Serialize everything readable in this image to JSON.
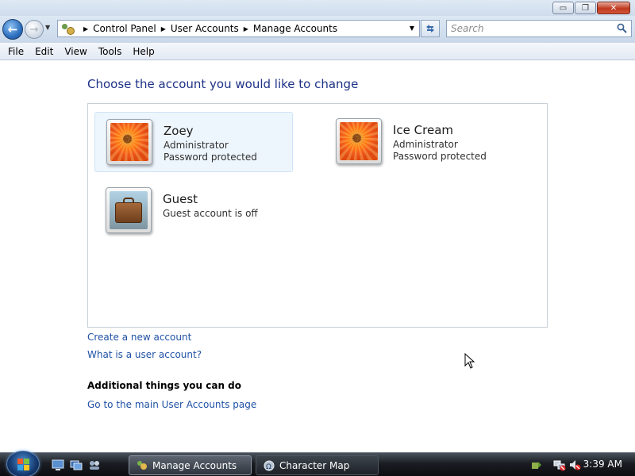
{
  "window": {
    "buttons": {
      "minimize": "▭",
      "maximize": "❐",
      "close": "✕"
    }
  },
  "nav": {
    "breadcrumbs": [
      "Control Panel",
      "User Accounts",
      "Manage Accounts"
    ],
    "search_placeholder": "Search",
    "back_glyph": "←",
    "forward_glyph": "→"
  },
  "menu": [
    "File",
    "Edit",
    "View",
    "Tools",
    "Help"
  ],
  "main": {
    "heading": "Choose the account you would like to change",
    "accounts": [
      {
        "name": "Zoey",
        "line1": "Administrator",
        "line2": "Password protected",
        "picture": "orange-flower-icon",
        "selected": true
      },
      {
        "name": "Ice Cream",
        "line1": "Administrator",
        "line2": "Password protected",
        "picture": "orange-flower-icon",
        "selected": false
      },
      {
        "name": "Guest",
        "line1": "Guest account is off",
        "line2": "",
        "picture": "suitcase-icon",
        "selected": false
      }
    ],
    "links": [
      "Create a new account",
      "What is a user account?"
    ],
    "additional_heading": "Additional things you can do",
    "additional_links": [
      "Go to the main User Accounts page"
    ]
  },
  "taskbar": {
    "tasks": [
      {
        "label": "Manage Accounts",
        "active": true
      },
      {
        "label": "Character Map",
        "active": false
      }
    ],
    "clock": "3:39 AM"
  },
  "colors": {
    "heading": "#1e3287",
    "link": "#1f51a6",
    "selected_bg": "#eef6fd"
  }
}
